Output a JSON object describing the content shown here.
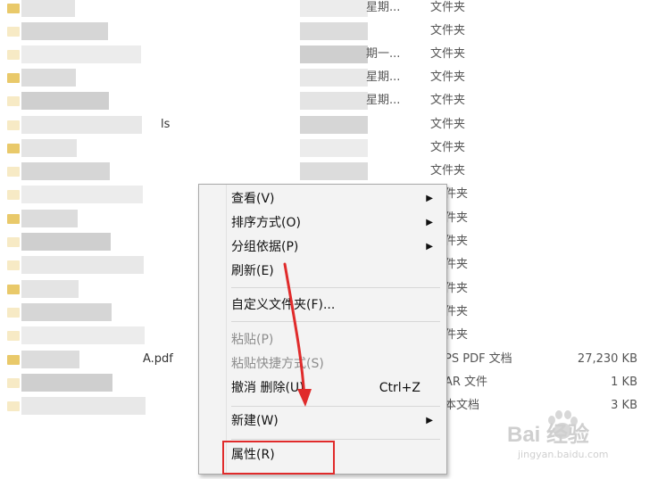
{
  "files": [
    {
      "date": "星期...",
      "type": "文件夹",
      "size": ""
    },
    {
      "date": "",
      "type": "文件夹",
      "size": ""
    },
    {
      "date": "期一...",
      "type": "文件夹",
      "size": ""
    },
    {
      "date": "星期...",
      "type": "文件夹",
      "size": ""
    },
    {
      "date": "星期...",
      "type": "文件夹",
      "size": ""
    },
    {
      "date": "",
      "type": "文件夹",
      "size": "",
      "name_tail": "ls"
    },
    {
      "date": "",
      "type": "文件夹",
      "size": ""
    },
    {
      "date": "",
      "type": "文件夹",
      "size": ""
    },
    {
      "date": "",
      "type": "件夹",
      "size": ""
    },
    {
      "date": "",
      "type": "件夹",
      "size": ""
    },
    {
      "date": "",
      "type": "件夹",
      "size": ""
    },
    {
      "date": "",
      "type": "件夹",
      "size": ""
    },
    {
      "date": "",
      "type": "件夹",
      "size": ""
    },
    {
      "date": "",
      "type": "件夹",
      "size": ""
    },
    {
      "date": "",
      "type": "件夹",
      "size": ""
    },
    {
      "date": "",
      "type": "PS PDF 文档",
      "size": "27,230 KB",
      "name_tail": "A.pdf"
    },
    {
      "date": "",
      "type": "AR 文件",
      "size": "1 KB"
    },
    {
      "date": "",
      "type": "本文档",
      "size": "3 KB"
    }
  ],
  "menu": {
    "items": [
      {
        "label": "查看(V)",
        "submenu": true,
        "disabled": false
      },
      {
        "label": "排序方式(O)",
        "submenu": true,
        "disabled": false
      },
      {
        "label": "分组依据(P)",
        "submenu": true,
        "disabled": false
      },
      {
        "label": "刷新(E)",
        "submenu": false,
        "disabled": false
      },
      {
        "label": "自定义文件夹(F)...",
        "submenu": false,
        "disabled": false
      },
      {
        "label": "粘贴(P)",
        "submenu": false,
        "disabled": true
      },
      {
        "label": "粘贴快捷方式(S)",
        "submenu": false,
        "disabled": true
      },
      {
        "label": "撤消 删除(U)",
        "submenu": false,
        "disabled": false,
        "accelerator": "Ctrl+Z"
      },
      {
        "label": "新建(W)",
        "submenu": true,
        "disabled": false
      },
      {
        "label": "属性(R)",
        "submenu": false,
        "disabled": false
      }
    ],
    "submenu_glyph": "▶"
  },
  "watermark": {
    "text": "Bai 经验",
    "subtext": "jingyan.baidu.com"
  },
  "colors": {
    "highlight": "#e02b2b",
    "folder": "#e7c35a",
    "menu_bg": "#f3f3f3"
  }
}
